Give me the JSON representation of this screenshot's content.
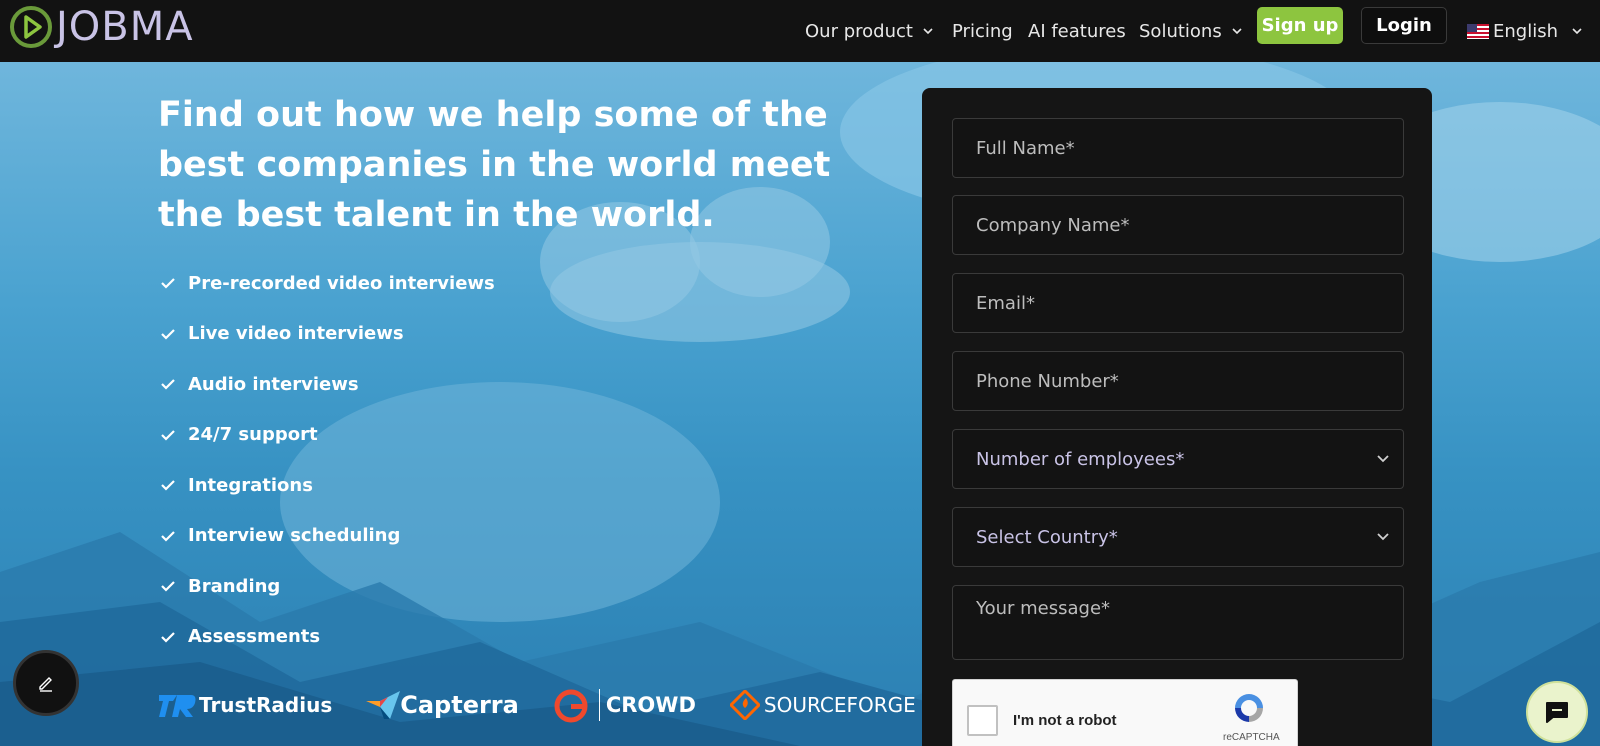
{
  "nav": {
    "brand": "JOBMA",
    "items": [
      {
        "label": "Our product",
        "dropdown": true
      },
      {
        "label": "Pricing",
        "dropdown": false
      },
      {
        "label": "AI features",
        "dropdown": false
      },
      {
        "label": "Solutions",
        "dropdown": true
      }
    ],
    "signup": "Sign up",
    "login": "Login",
    "language": "English",
    "colors": {
      "signup": "#8dc53f",
      "bar": "#121212",
      "logo": "#c9c3e6"
    }
  },
  "hero": {
    "headline": "Find out how we help some of the best companies in the world meet the best talent in the world.",
    "features": [
      "Pre-recorded video interviews",
      "Live video interviews",
      "Audio interviews",
      "24/7 support",
      "Integrations",
      "Interview scheduling",
      "Branding",
      "Assessments"
    ],
    "brands": [
      "TrustRadius",
      "Capterra",
      "CROWD",
      "SOURCEFORGE"
    ]
  },
  "form": {
    "full_name": "Full Name*",
    "company_name": "Company Name*",
    "email": "Email*",
    "phone": "Phone Number*",
    "employees": "Number of employees*",
    "country": "Select Country*",
    "message": "Your message*",
    "captcha_label": "I'm not a robot",
    "captcha_brand": "reCAPTCHA"
  },
  "icons": [
    "play-logo-icon",
    "chevron-down-icon",
    "us-flag-icon",
    "check-icon",
    "edit-icon",
    "chat-icon",
    "recaptcha-icon"
  ]
}
